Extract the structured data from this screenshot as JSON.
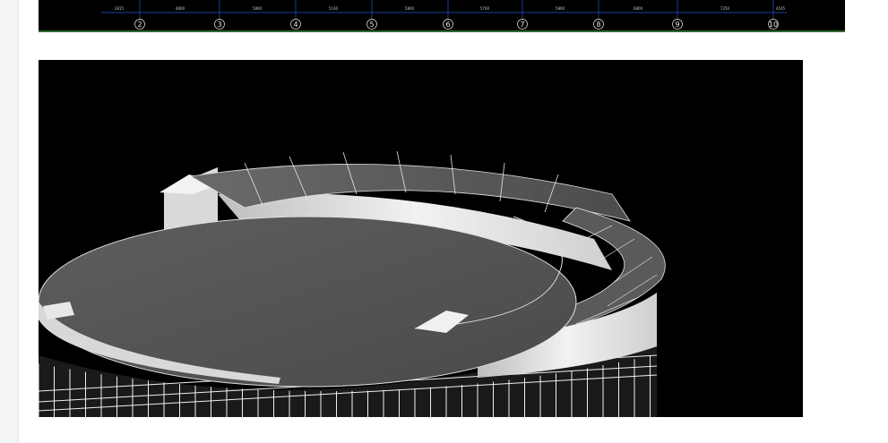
{
  "cad_drawing": {
    "axis_labels": [
      "2",
      "3",
      "4",
      "5",
      "6",
      "7",
      "8",
      "9",
      "10"
    ],
    "dimension_labels": [
      "2815",
      "4800",
      "5800",
      "5100",
      "5800",
      "5700",
      "5800",
      "6800",
      "7250",
      "4165"
    ]
  },
  "colors": {
    "page_background": "#ffffff",
    "cad_background": "#000000",
    "cad_line": "#1e5ccf",
    "cad_ground_line": "#2f6a2f",
    "roof_gray": "#5a5a5a",
    "facade_white": "#e8e8e8",
    "brick_red": "#7a2f1c"
  }
}
